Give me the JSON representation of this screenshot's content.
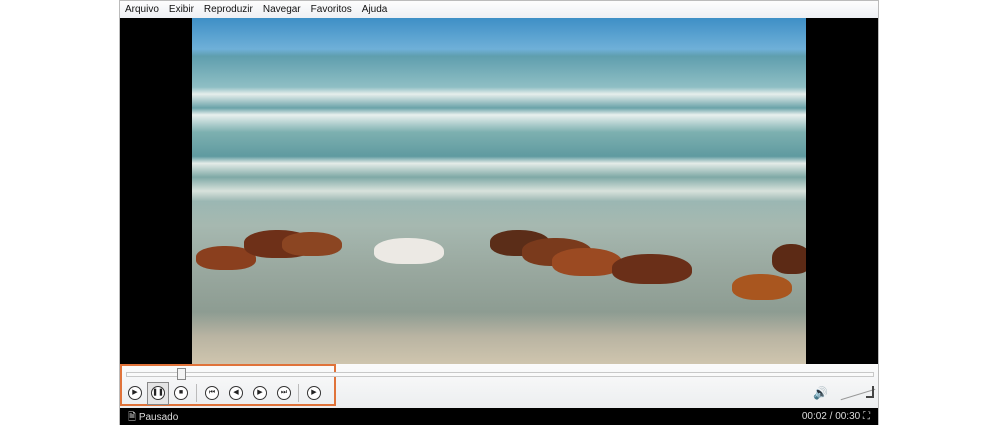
{
  "menu": [
    "Arquivo",
    "Exibir",
    "Reproduzir",
    "Navegar",
    "Favoritos",
    "Ajuda"
  ],
  "playback": {
    "progress": 0.067,
    "time": "00:02 / 00:30",
    "status": "Pausado"
  },
  "colors": {
    "highlight": "#e0733a",
    "status_bg": "#000000"
  }
}
